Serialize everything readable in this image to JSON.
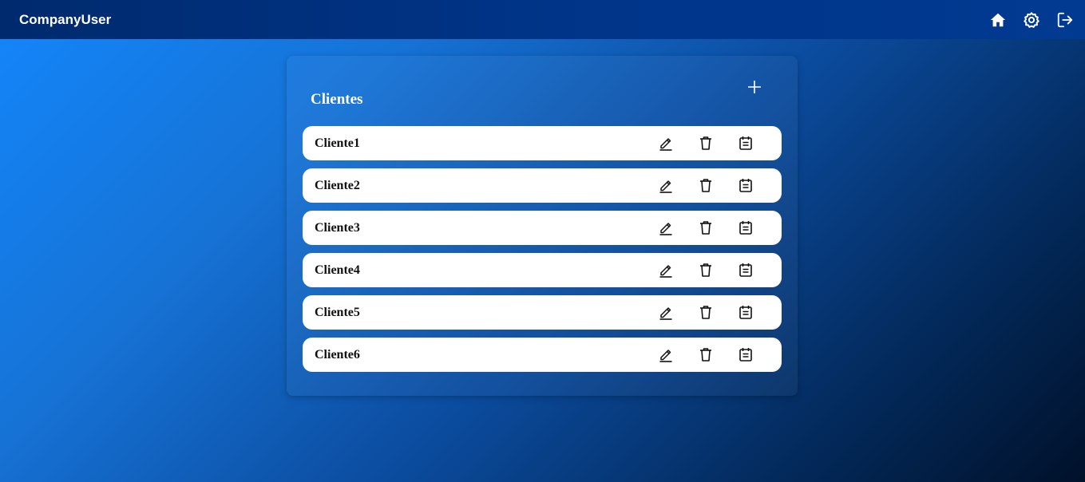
{
  "header": {
    "brand": "CompanyUser",
    "icons": [
      "home-icon",
      "settings-icon",
      "logout-icon"
    ]
  },
  "panel": {
    "title": "Clientes",
    "add_icon": "plus-icon"
  },
  "clients": [
    {
      "name": "Cliente1"
    },
    {
      "name": "Cliente2"
    },
    {
      "name": "Cliente3"
    },
    {
      "name": "Cliente4"
    },
    {
      "name": "Cliente5"
    },
    {
      "name": "Cliente6"
    }
  ],
  "row_actions": [
    "edit-icon",
    "trash-icon",
    "notes-icon"
  ],
  "colors": {
    "header": "#00358a",
    "background_start": "#1386fb",
    "background_end": "#00112a",
    "row": "#ffffff"
  }
}
